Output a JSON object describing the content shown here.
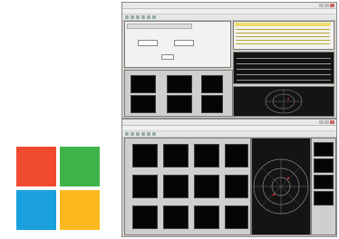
{
  "logo": {
    "name": "windows-logo",
    "colors": {
      "top_left": "#f04b30",
      "top_right": "#3db34a",
      "bottom_left": "#1aa0dc",
      "bottom_right": "#fbb81f"
    }
  },
  "windows": [
    {
      "id": "top-window",
      "state": "configuration tabs, data grid, signal traces, polar scope"
    },
    {
      "id": "bottom-window",
      "state": "channel value grid and large polar scope"
    }
  ]
}
